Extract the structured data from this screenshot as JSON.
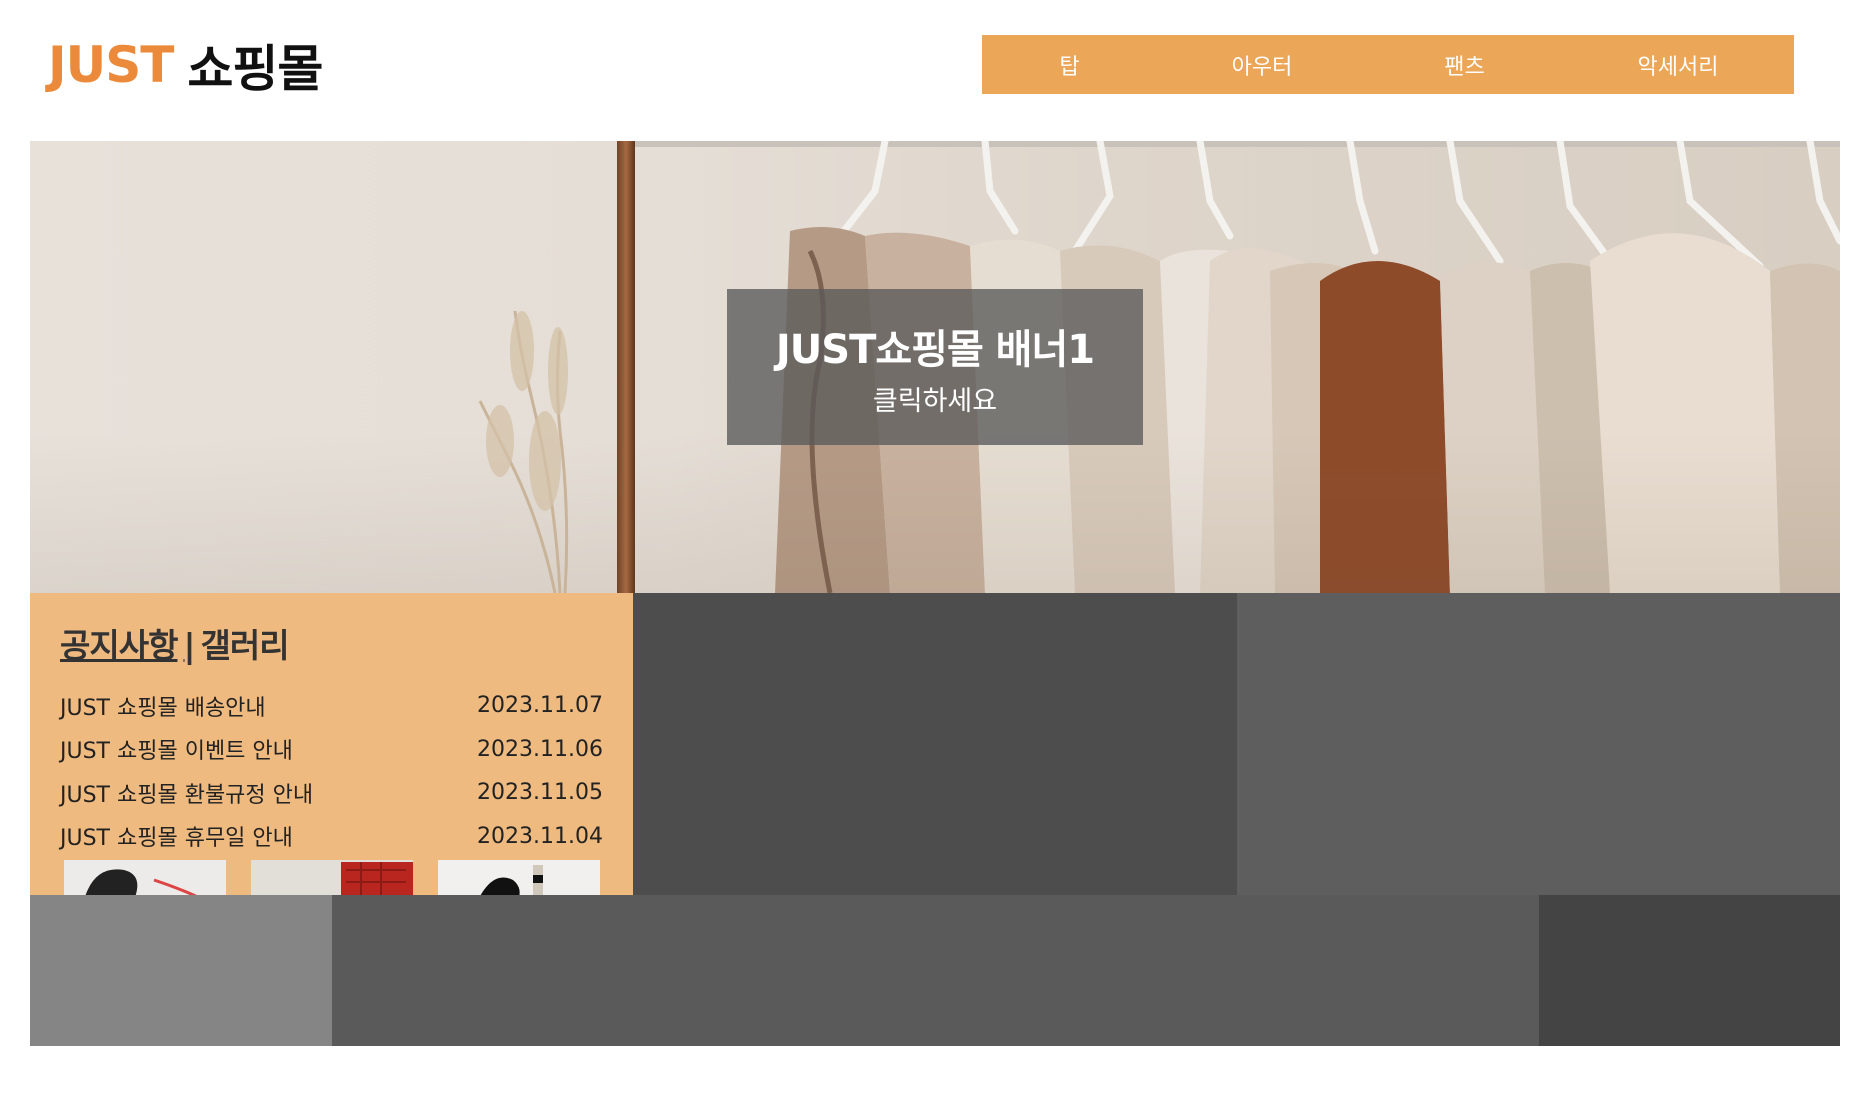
{
  "header": {
    "logo_just": "JUST",
    "logo_mall": "쇼핑몰",
    "nav": [
      {
        "label": "탑"
      },
      {
        "label": "아우터"
      },
      {
        "label": "팬츠"
      },
      {
        "label": "악세서리"
      }
    ]
  },
  "banner": {
    "title": "JUST쇼핑몰 배너1",
    "subtitle": "클릭하세요"
  },
  "notice": {
    "tab_notice": "공지사항",
    "separator": "|",
    "tab_gallery": "갤러리",
    "items": [
      {
        "title": "JUST 쇼핑몰 배송안내",
        "date": "2023.11.07"
      },
      {
        "title": "JUST 쇼핑몰 이벤트 안내",
        "date": "2023.11.06"
      },
      {
        "title": "JUST 쇼핑몰 환불규정 안내",
        "date": "2023.11.05"
      },
      {
        "title": "JUST 쇼핑몰 휴무일 안내",
        "date": "2023.11.04"
      }
    ]
  },
  "colors": {
    "brand_orange": "#ea8a3a",
    "nav_background": "#eba657",
    "notice_background": "#efba7f"
  }
}
